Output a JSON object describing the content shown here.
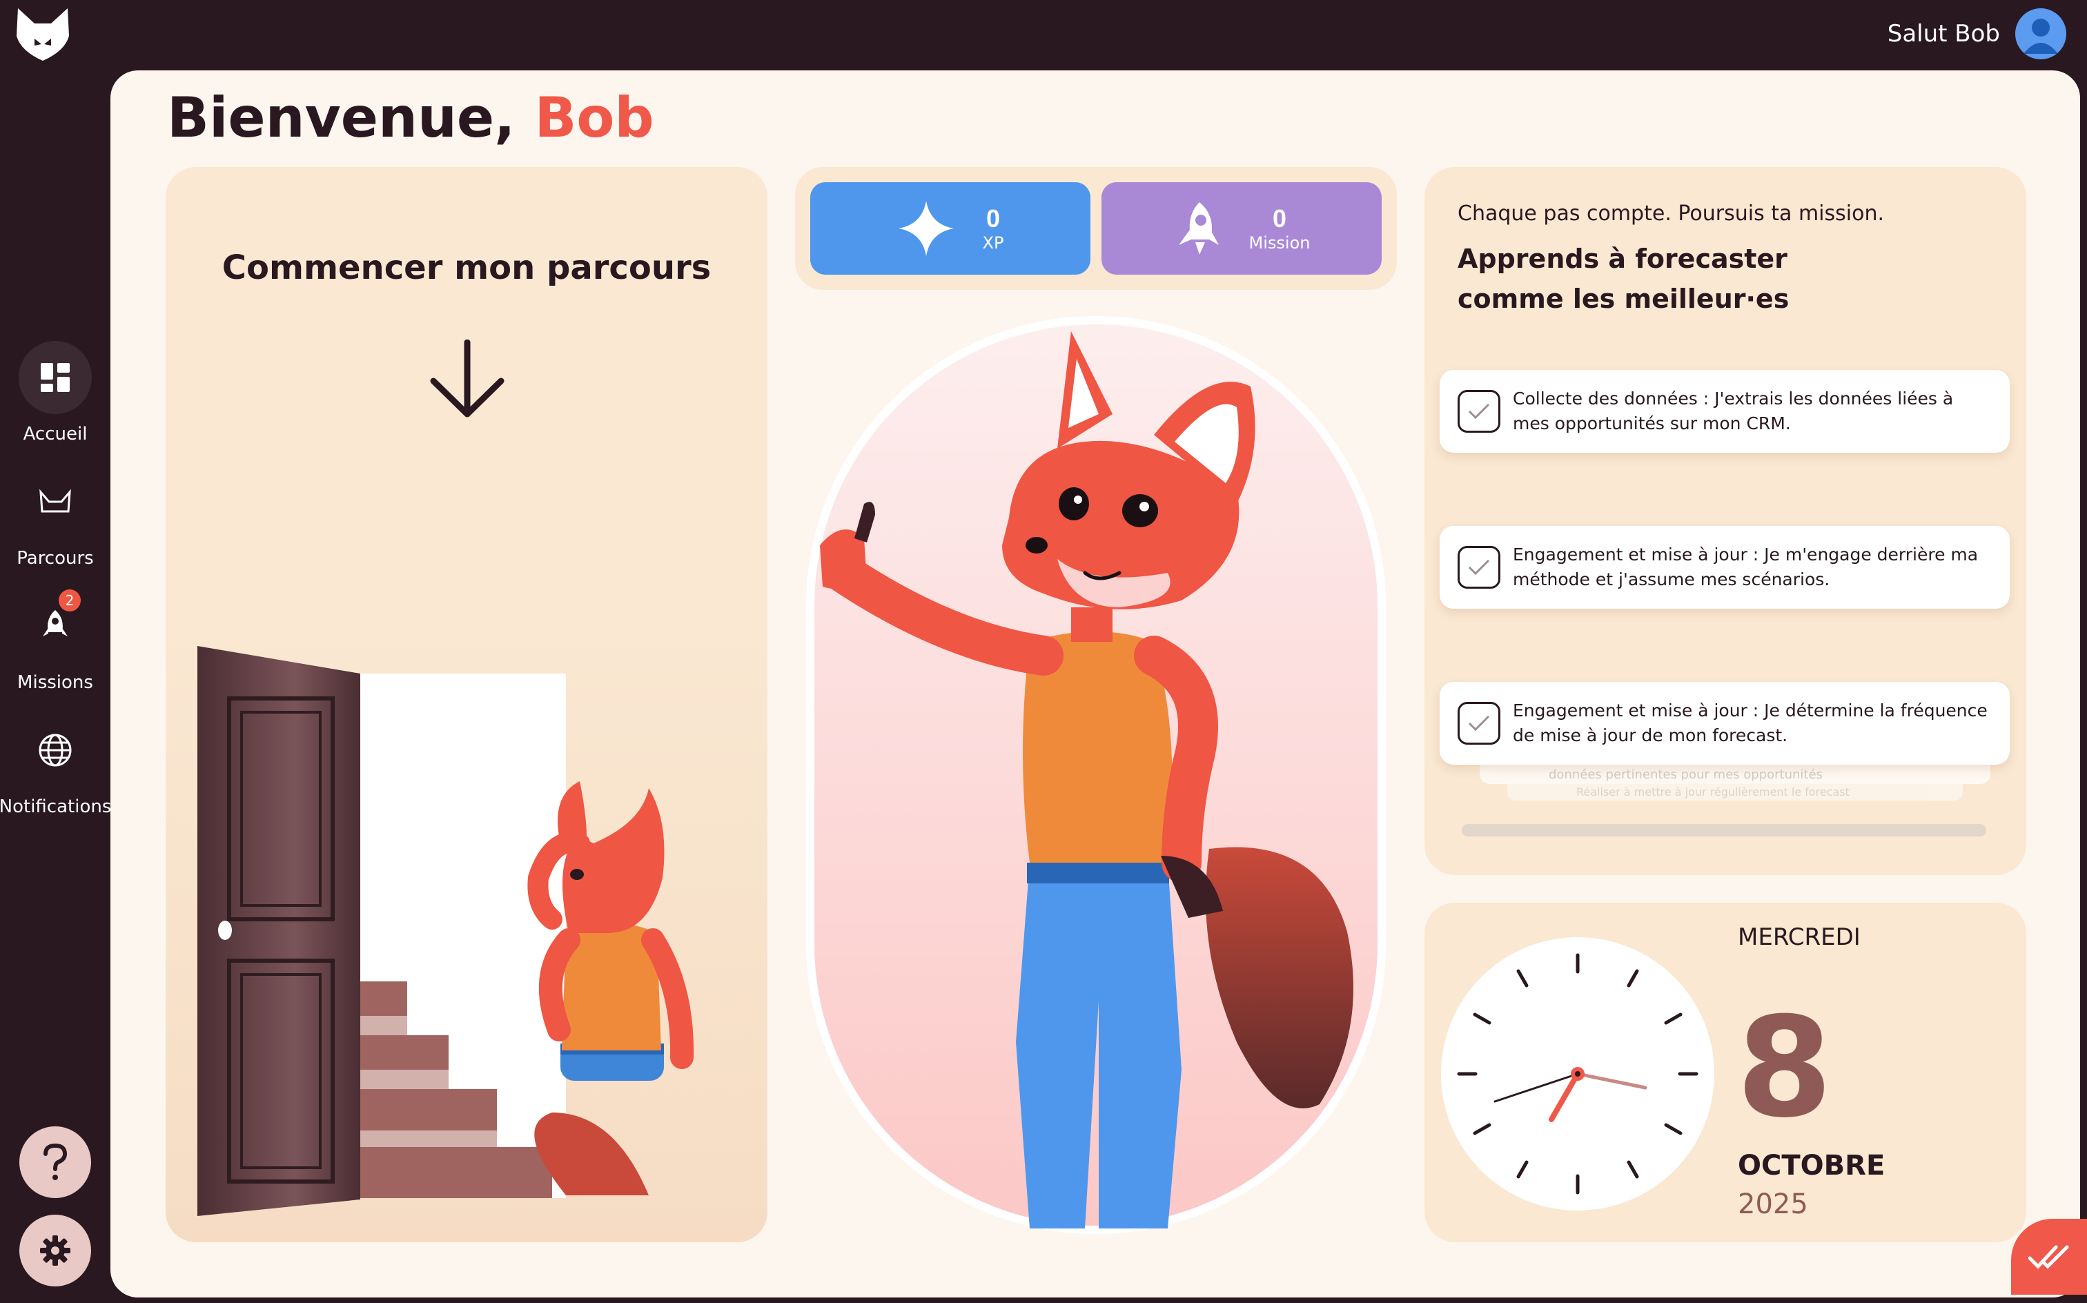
{
  "header": {
    "logo_icon": "fox-logo-icon",
    "greeting": "Salut Bob",
    "avatar_icon": "user-avatar-icon"
  },
  "sidebar": {
    "items": [
      {
        "label": "Accueil",
        "icon": "dashboard-icon",
        "active": true
      },
      {
        "label": "Parcours",
        "icon": "fox-mask-icon"
      },
      {
        "label": "Missions",
        "icon": "rocket-icon",
        "badge": "2"
      },
      {
        "label": "Notifications",
        "icon": "globe-icon"
      }
    ],
    "help_icon": "question-icon",
    "settings_icon": "gear-icon"
  },
  "main": {
    "title_prefix": "Bienvenue,",
    "title_name": "Bob",
    "start": {
      "heading": "Commencer mon parcours"
    },
    "stats": {
      "xp_value": "0",
      "xp_label": "XP",
      "mission_value": "0",
      "mission_label": "Mission"
    },
    "mission": {
      "subtitle": "Chaque pas compte.  Poursuis ta mission.",
      "title": "Apprends à forecaster comme les meilleur·es",
      "tasks": [
        {
          "text": "Collecte des données : J'extrais les données liées à mes opportunités sur mon CRM."
        },
        {
          "text": "Engagement et mise à jour : Je m'engage derrière ma méthode et j'assume mes scénarios."
        },
        {
          "text": "Engagement et mise à jour : Je détermine la fréquence de mise à jour de mon forecast."
        }
      ],
      "ghost_1": "données pertinentes pour mes opportunités",
      "ghost_2": "Réaliser à mettre à jour régulièrement le forecast"
    },
    "date": {
      "day_name": "MERCREDI",
      "day_number": "8",
      "month": "OCTOBRE",
      "year": "2025"
    }
  },
  "colors": {
    "background": "#2a1820",
    "panel": "#fdf6ef",
    "card": "#fae8d2",
    "accent": "#f0584a",
    "xp": "#4f97ec",
    "mission": "#a988d6"
  }
}
